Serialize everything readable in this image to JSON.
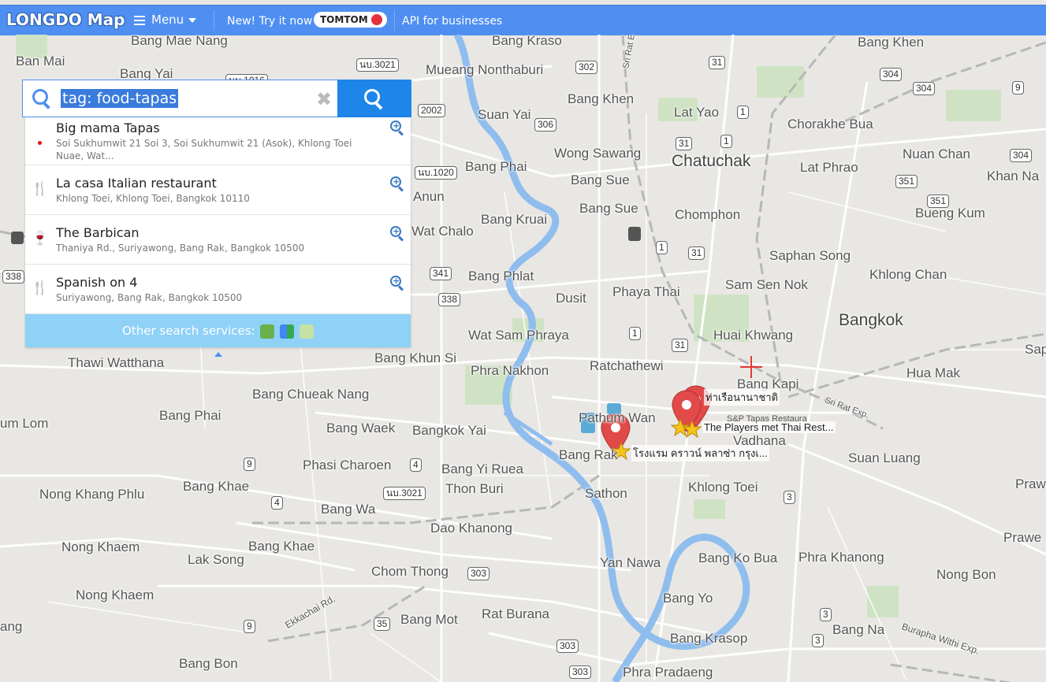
{
  "topbar": {
    "logo": "LONGDO Map",
    "menu_label": "Menu",
    "try_label": "New! Try it now",
    "tomtom_label": "TOMTOM",
    "api_label": "API for businesses"
  },
  "search": {
    "query": "tag: food-tapas",
    "placeholder": "",
    "clear_symbol": "✖"
  },
  "results": [
    {
      "title": "Big mama Tapas",
      "address": "Soi Sukhumwit 21 Soi 3, Soi Sukhumwit 21 (Asok), Khlong Toei Nuae, Wat...",
      "icon": "red-dot-icon"
    },
    {
      "title": "La casa Italian restaurant",
      "address": "Khlong Toei, Khlong Toei, Bangkok 10110",
      "icon": "restaurant-icon"
    },
    {
      "title": "The Barbican",
      "address": "Thaniya Rd., Suriyawong, Bang Rak, Bangkok 10500",
      "icon": "bar-icon"
    },
    {
      "title": "Spanish on 4",
      "address": "Suriyawong, Bang Rak, Bangkok 10500",
      "icon": "restaurant-icon"
    }
  ],
  "other_services_label": "Other search services:",
  "map": {
    "labels": [
      "Bang Mae Nang",
      "Ban Mai",
      "Bang Yai",
      "Mueang Nonthaburi",
      "Bang Kraso",
      "Bang Khen",
      "Bang Khen",
      "Suan Yai",
      "Lat Yao",
      "Chorakhe Bua",
      "Wong Sawang",
      "Chatuchak",
      "Nuan Chan",
      "Lat Phrao",
      "Khan Na",
      "Bang Phai",
      "Bang Sue",
      "Bang Sue",
      "Chomphon",
      "Bueng Kum",
      "Anun",
      "Bang Kruai",
      "Wat Chalo",
      "Saphan Song",
      "Bang Phlat",
      "Phaya Thai",
      "Dusit",
      "Khlong Chan",
      "Sam Sen Nok",
      "Bangkok",
      "Wat Sam Phraya",
      "Huai Khwang",
      "Sap",
      "Phra Nakhon",
      "Ratchathewi",
      "Thawi Watthana",
      "Bang Khun Si",
      "Hua Mak",
      "Bang Kapi",
      "Bang Chueak Nang",
      "Pathum Wan",
      "Bang Phai",
      "Bang Waek",
      "Bangkok Yai",
      "Vadhana",
      "Suan Luang",
      "um Lom",
      "Phasi Charoen",
      "Bang Yi Ruea",
      "Bang Rak",
      "Bang Khae",
      "Thon Buri",
      "Sathon",
      "Khlong Toei",
      "Nong Khang Phlu",
      "Bang Wa",
      "Dao Khanong",
      "Praw",
      "Nong Khaem",
      "Bang Khae",
      "Lak Song",
      "Bang Ko Bua",
      "Phra Khanong",
      "Prawe",
      "Chom Thong",
      "Yan Nawa",
      "Nong Khaem",
      "Nong Bon",
      "Bang Yo",
      "Rat Burana",
      "ang",
      "Bang Mot",
      "Bang Krasop",
      "Bang Na",
      "Bang Bon",
      "Phra Pradaeng",
      "Ekkachai Rd.",
      "Burapha Withi Exp.",
      "Sri Rat Exp.",
      "Sri Rat Exp."
    ],
    "shields": [
      "นบ.3021",
      "นบ.1016",
      "302",
      "31",
      "304",
      "304",
      "9",
      "2002",
      "306",
      "1",
      "31",
      "1",
      "304",
      "นบ.1020",
      "351",
      "351",
      "338",
      "1",
      "31",
      "341",
      "338",
      "1",
      "31",
      "9",
      "4",
      "นบ.3021",
      "4",
      "3",
      "303",
      "35",
      "9",
      "303",
      "3",
      "3",
      "303"
    ],
    "poi_labels": [
      "ท่าเรือนานาชาติ",
      "The Players met Thai Rest...",
      "โรงแรม คราวน์ พลาซ่า กรุงเ...",
      "S&P Tapas Restaura"
    ]
  }
}
